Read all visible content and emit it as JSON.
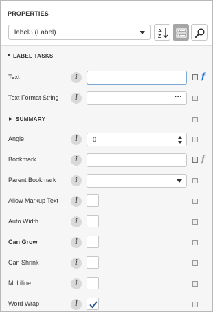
{
  "panel": {
    "title": "PROPERTIES",
    "object_selector": {
      "value": "label3 (Label)"
    },
    "toolbar": {
      "sort_icon": "sort-az-icon",
      "categorized_icon": "categorized-view-icon",
      "search_icon": "search-icon",
      "active": "categorized"
    }
  },
  "section": {
    "title": "LABEL TASKS",
    "expanded": true
  },
  "properties": {
    "text": {
      "label": "Text",
      "value": "",
      "fx_color": "#1e6fd9"
    },
    "text_format_string": {
      "label": "Text Format String",
      "value": "",
      "button": "···"
    },
    "summary": {
      "label": "SUMMARY",
      "expanded": false
    },
    "angle": {
      "label": "Angle",
      "value": "0"
    },
    "bookmark": {
      "label": "Bookmark",
      "value": "",
      "fx_color": "#9a9a9a"
    },
    "parent_bookmark": {
      "label": "Parent Bookmark",
      "value": ""
    },
    "allow_markup_text": {
      "label": "Allow Markup Text",
      "checked": false
    },
    "auto_width": {
      "label": "Auto Width",
      "checked": false
    },
    "can_grow": {
      "label": "Can Grow",
      "checked": false
    },
    "can_shrink": {
      "label": "Can Shrink",
      "checked": false
    },
    "multiline": {
      "label": "Multiline",
      "checked": false
    },
    "word_wrap": {
      "label": "Word Wrap",
      "checked": true
    }
  },
  "info_glyph": "i",
  "colors": {
    "checkmark": "#1f4e8c",
    "focus_border": "#7aa6d4",
    "active_button": "#a6a6a6"
  }
}
